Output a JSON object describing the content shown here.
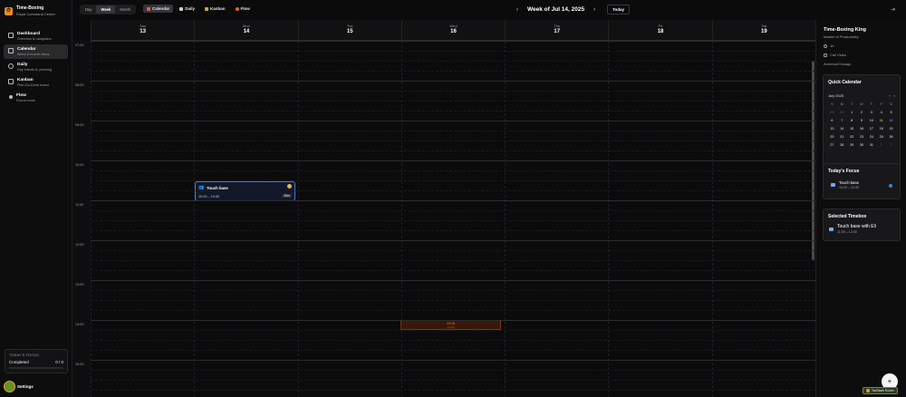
{
  "brand": {
    "title": "Time-Boxing",
    "subtitle": "Royal Command Center"
  },
  "nav": [
    {
      "label": "Dashboard",
      "sub": "Overview & navigation"
    },
    {
      "label": "Calendar",
      "sub": "Week & month views"
    },
    {
      "label": "Daily",
      "sub": "Day intents & planning"
    },
    {
      "label": "Kanban",
      "sub": "Plan-Do-Done board"
    },
    {
      "label": "Flow",
      "sub": "Focus mode"
    }
  ],
  "focus": {
    "title": "TODAY'S FOCUS",
    "label": "Completed",
    "value": "0 / 0"
  },
  "settings_label": "Settings",
  "toolbar": {
    "ranges": [
      "Day",
      "Week",
      "Month"
    ],
    "views": [
      "Calendar",
      "Daily",
      "Kanban",
      "Flow"
    ],
    "prev": "‹",
    "next": "›",
    "week_title": "Week of Jul 14, 2025",
    "today": "Today",
    "collapse": "⇥"
  },
  "days": [
    {
      "name": "Sun",
      "date": "13"
    },
    {
      "name": "Mon",
      "date": "14"
    },
    {
      "name": "Tue",
      "date": "15"
    },
    {
      "name": "Wed",
      "date": "16"
    },
    {
      "name": "Thu",
      "date": "17"
    },
    {
      "name": "Fri",
      "date": "18"
    },
    {
      "name": "Sat",
      "date": "19"
    }
  ],
  "times": [
    "07:00",
    "08:00",
    "09:00",
    "10:00",
    "11:00",
    "12:00",
    "13:00",
    "14:00",
    "15:00"
  ],
  "event": {
    "title": "Touch base",
    "time": "10:00 – 10:30",
    "tag": "30m"
  },
  "now_marker": {
    "time": "13:18",
    "sub": "13:00"
  },
  "profile": {
    "name": "Time-Boxing King",
    "role": "Master of Productivity",
    "hours": "1h",
    "call": "Call Video",
    "tz": "America/Chicago"
  },
  "quick_calendar": {
    "title": "Quick Calendar",
    "month": "July 2025",
    "weekdays": [
      "S",
      "M",
      "T",
      "W",
      "T",
      "F",
      "S"
    ],
    "cells": [
      [
        "29",
        "dim"
      ],
      [
        "30",
        "dim"
      ],
      [
        "1",
        ""
      ],
      [
        "2",
        ""
      ],
      [
        "3",
        ""
      ],
      [
        "4",
        ""
      ],
      [
        "5",
        ""
      ],
      [
        "6",
        ""
      ],
      [
        "7",
        ""
      ],
      [
        "8",
        ""
      ],
      [
        "9",
        ""
      ],
      [
        "10",
        ""
      ],
      [
        "11",
        ""
      ],
      [
        "12",
        "today"
      ],
      [
        "13",
        ""
      ],
      [
        "14",
        ""
      ],
      [
        "15",
        ""
      ],
      [
        "16",
        ""
      ],
      [
        "17",
        ""
      ],
      [
        "18",
        ""
      ],
      [
        "19",
        ""
      ],
      [
        "20",
        ""
      ],
      [
        "21",
        ""
      ],
      [
        "22",
        ""
      ],
      [
        "23",
        ""
      ],
      [
        "24",
        ""
      ],
      [
        "25",
        ""
      ],
      [
        "26",
        ""
      ],
      [
        "27",
        ""
      ],
      [
        "28",
        ""
      ],
      [
        "29",
        ""
      ],
      [
        "30",
        ""
      ],
      [
        "31",
        ""
      ],
      [
        "1",
        "dim"
      ],
      [
        "2",
        "dim"
      ]
    ]
  },
  "todays_focus": {
    "title": "Today's Focus",
    "item_title": "Touch base",
    "item_time": "10:00 – 10:30"
  },
  "selected_timebox": {
    "title": "Selected Timebox",
    "item_title": "Touch base with Eli",
    "item_time": "11:30 – 12:00"
  },
  "fab": "+",
  "devtools": "TanStack Router"
}
